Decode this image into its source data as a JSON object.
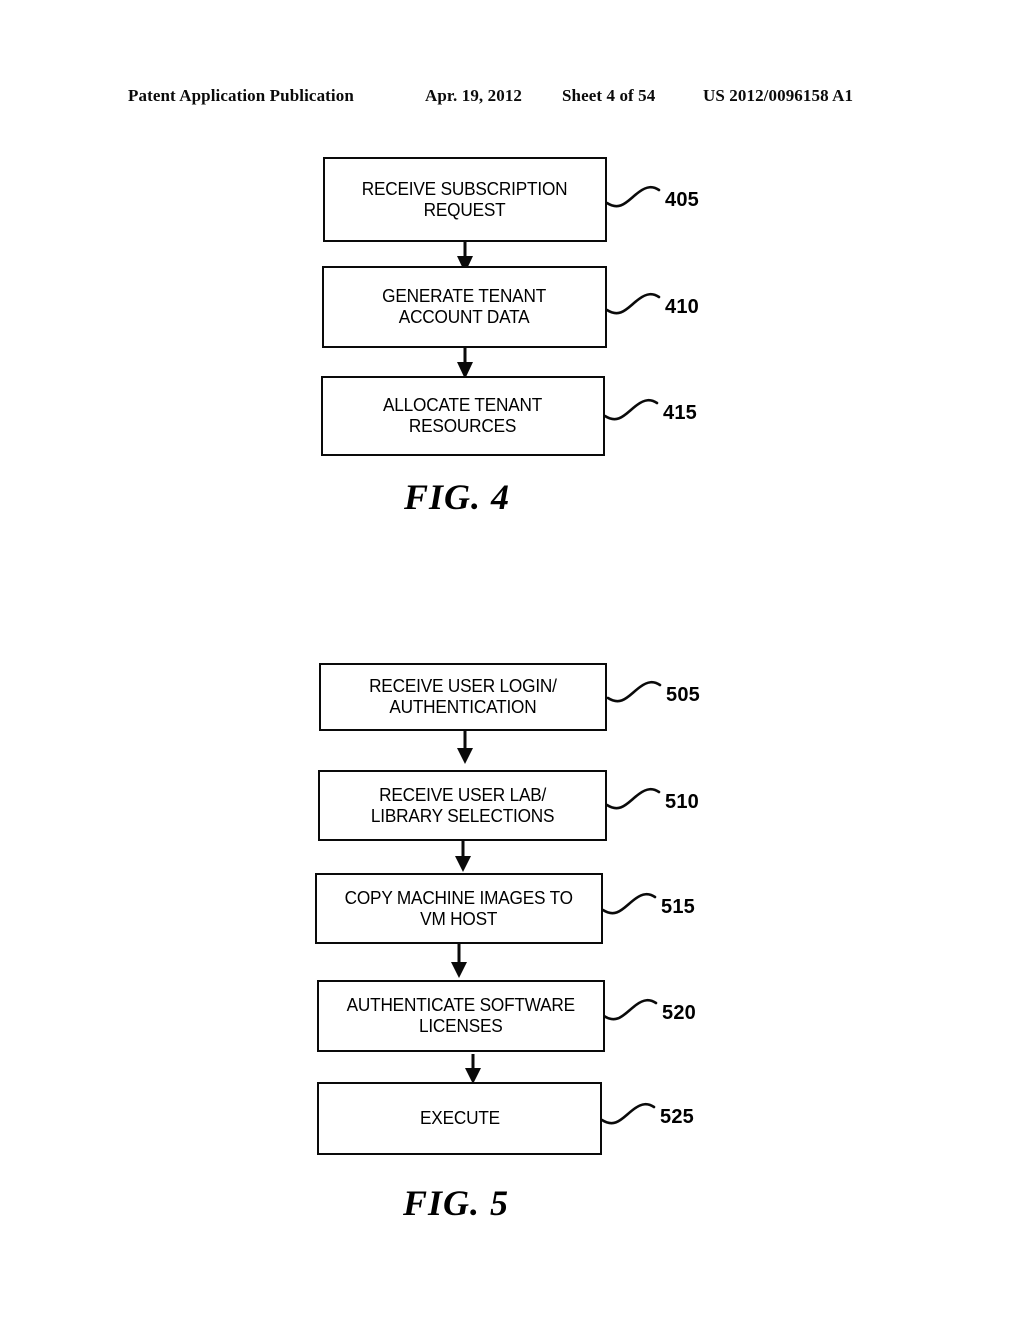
{
  "header": {
    "publication": "Patent Application Publication",
    "date": "Apr. 19, 2012",
    "sheet": "Sheet 4 of 54",
    "patent_number": "US 2012/0096158 A1"
  },
  "figures": [
    {
      "id": "fig-4",
      "caption": "FIG. 4",
      "steps": [
        {
          "ref": "405",
          "text": "RECEIVE SUBSCRIPTION\nREQUEST"
        },
        {
          "ref": "410",
          "text": "GENERATE TENANT\nACCOUNT DATA"
        },
        {
          "ref": "415",
          "text": "ALLOCATE TENANT\nRESOURCES"
        }
      ]
    },
    {
      "id": "fig-5",
      "caption": "FIG. 5",
      "steps": [
        {
          "ref": "505",
          "text": "RECEIVE USER LOGIN/\nAUTHENTICATION"
        },
        {
          "ref": "510",
          "text": "RECEIVE USER LAB/\nLIBRARY SELECTIONS"
        },
        {
          "ref": "515",
          "text": "COPY MACHINE IMAGES TO\nVM HOST"
        },
        {
          "ref": "520",
          "text": "AUTHENTICATE SOFTWARE\nLICENSES"
        },
        {
          "ref": "525",
          "text": "EXECUTE"
        }
      ]
    }
  ],
  "colors": {
    "ink": "#000000",
    "paper": "#ffffff"
  }
}
